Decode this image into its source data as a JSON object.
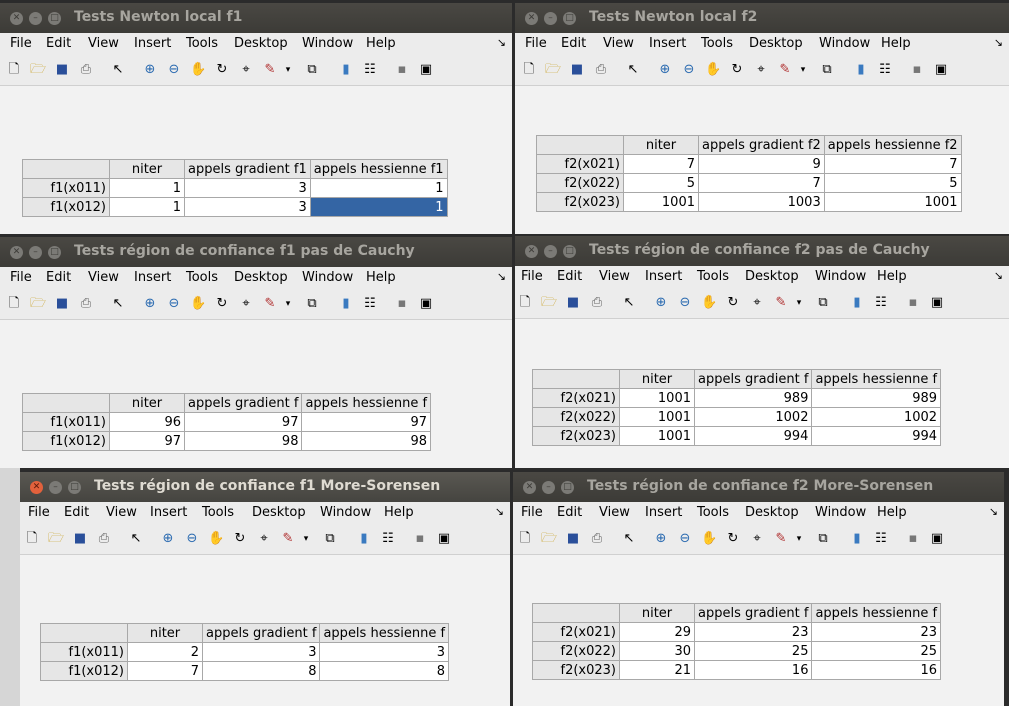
{
  "menu": [
    "File",
    "Edit",
    "View",
    "Insert",
    "Tools",
    "Desktop",
    "Window",
    "Help"
  ],
  "windows": [
    {
      "title": "Tests Newton local f1",
      "headers": [
        "niter",
        "appels gradient f1",
        "appels hessienne f1"
      ],
      "rows": [
        [
          "f1(x011)",
          "1",
          "3",
          "1"
        ],
        [
          "f1(x012)",
          "1",
          "3",
          "1"
        ]
      ]
    },
    {
      "title": "Tests Newton local f2",
      "headers": [
        "niter",
        "appels gradient f2",
        "appels hessienne f2"
      ],
      "rows": [
        [
          "f2(x021)",
          "7",
          "9",
          "7"
        ],
        [
          "f2(x022)",
          "5",
          "7",
          "5"
        ],
        [
          "f2(x023)",
          "1001",
          "1003",
          "1001"
        ]
      ]
    },
    {
      "title": "Tests région de confiance f1 pas de Cauchy",
      "headers": [
        "niter",
        "appels gradient f",
        "appels hessienne f"
      ],
      "rows": [
        [
          "f1(x011)",
          "96",
          "97",
          "97"
        ],
        [
          "f1(x012)",
          "97",
          "98",
          "98"
        ]
      ]
    },
    {
      "title": "Tests région de confiance f2 pas de Cauchy",
      "headers": [
        "niter",
        "appels gradient f",
        "appels hessienne f"
      ],
      "rows": [
        [
          "f2(x021)",
          "1001",
          "989",
          "989"
        ],
        [
          "f2(x022)",
          "1001",
          "1002",
          "1002"
        ],
        [
          "f2(x023)",
          "1001",
          "994",
          "994"
        ]
      ]
    },
    {
      "title": "Tests région de confiance f1 More-Sorensen",
      "headers": [
        "niter",
        "appels gradient f",
        "appels hessienne f"
      ],
      "rows": [
        [
          "f1(x011)",
          "2",
          "3",
          "3"
        ],
        [
          "f1(x012)",
          "7",
          "8",
          "8"
        ]
      ]
    },
    {
      "title": "Tests région de confiance f2 More-Sorensen",
      "headers": [
        "niter",
        "appels gradient f",
        "appels hessienne f"
      ],
      "rows": [
        [
          "f2(x021)",
          "29",
          "23",
          "23"
        ],
        [
          "f2(x022)",
          "30",
          "25",
          "25"
        ],
        [
          "f2(x023)",
          "21",
          "16",
          "16"
        ]
      ]
    }
  ]
}
